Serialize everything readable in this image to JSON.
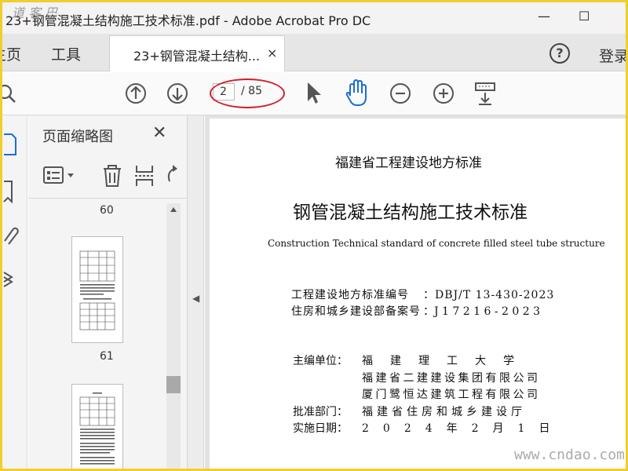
{
  "window": {
    "title": "23+钢管混凝土结构施工技术标准.pdf - Adobe Acrobat Pro DC",
    "minimize": "—",
    "maximize": "☐"
  },
  "menubar": {
    "home": "主页",
    "tools": "工具",
    "doc_tab": "23+钢管混凝土结构...",
    "doc_tab_close": "×",
    "help": "?",
    "login": "登录"
  },
  "toolbar": {
    "page_current": "2",
    "page_total": "/ 85"
  },
  "thumbnails": {
    "title": "页面缩略图",
    "close": "✕",
    "labels": [
      "60",
      "61"
    ]
  },
  "document": {
    "line1": "福建省工程建设地方标准",
    "line2": "钢管混凝土结构施工技术标准",
    "line3": "Construction Technical standard of concrete filled steel tube structure",
    "label_std_no": "工程建设地方标准编号",
    "std_no": "：DBJ/T 13-430-2023",
    "label_record_no": "住房和城乡建设部备案号",
    "record_no": "：J 1 7 2 1 6 - 2 0 2 3",
    "label_editor": "主编单位：",
    "editor1": "福　建　理　工　大　学",
    "editor2": "福建省二建建设集团有限公司",
    "editor3": "厦门鹭恒达建筑工程有限公司",
    "label_approver": "批准部门：",
    "approver": "福建省住房和城乡建设厅",
    "label_date": "实施日期：",
    "date": "2　0　2　4　年　2　月　1　日"
  },
  "watermarks": {
    "top_left": "道 客 巴",
    "bottom_right": "www.cndao.com"
  }
}
